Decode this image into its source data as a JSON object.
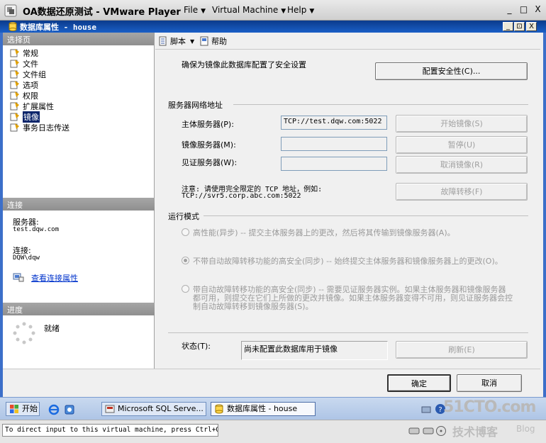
{
  "vmware": {
    "title": "OA数据还原测试 - VMware Player",
    "menus": [
      "File",
      "Virtual Machine",
      "Help"
    ],
    "window_controls": [
      "_",
      "□",
      "X"
    ]
  },
  "dialog": {
    "title": "数据库属性 - house",
    "controls": [
      "_",
      "⊡",
      "X"
    ]
  },
  "left_panel": {
    "select_page_header": "选择页",
    "pages": [
      "常规",
      "文件",
      "文件组",
      "选项",
      "权限",
      "扩展属性",
      "镜像",
      "事务日志传送"
    ],
    "selected_index": 6,
    "connection_header": "连接",
    "server_label": "服务器:",
    "server_value": "test.dqw.com",
    "connection_label": "连接:",
    "connection_value": "DQW\\dqw",
    "view_connection_link": "查看连接属性",
    "progress_header": "进度",
    "progress_status": "就绪"
  },
  "toolbar": {
    "script_label": "脚本",
    "help_label": "帮助"
  },
  "mirroring": {
    "security_note": "确保为镜像此数据库配置了安全设置",
    "configure_security_button": "配置安全性(C)...",
    "network_group": "服务器网络地址",
    "principal_label": "主体服务器(P):",
    "principal_value": "TCP://test.dqw.com:5022",
    "mirror_label": "镜像服务器(M):",
    "mirror_value": "",
    "witness_label": "见证服务器(W):",
    "witness_value": "",
    "start_button": "开始镜像(S)",
    "pause_button": "暂停(U)",
    "remove_button": "取消镜像(R)",
    "failover_button": "故障转移(F)",
    "note_line1": "注意: 请使用完全限定的 TCP 地址，例如:",
    "note_line2": "TCP://svr5.corp.abc.com:5022",
    "mode_group": "运行模式",
    "mode_high_perf": "高性能(异步) -- 提交主体服务器上的更改，然后将其传输到镜像服务器(A)。",
    "mode_high_safety": "不带自动故障转移功能的高安全(同步) -- 始终提交主体服务器和镜像服务器上的更改(O)。",
    "mode_auto_line1": "带自动故障转移功能的高安全(同步) -- 需要见证服务器实例。如果主体服务器和镜像服务器",
    "mode_auto_line2": "都可用，则提交在它们上所做的更改并镜像。如果主体服务器变得不可用，则见证服务器会控",
    "mode_auto_line3": "制自动故障转移到镜像服务器(S)。",
    "selected_mode": "high_safety",
    "status_label": "状态(T):",
    "status_value": "尚未配置此数据库用于镜像",
    "refresh_button": "刷新(E)"
  },
  "footer": {
    "ok_button": "确定",
    "cancel_button": "取消"
  },
  "taskbar": {
    "start_label": "开始",
    "items": [
      "Microsoft SQL Serve...",
      "数据库属性 - house"
    ]
  },
  "statusbar": {
    "text": "To direct input to this virtual machine, press Ctrl+G."
  },
  "watermark": {
    "site": "51CTO.com",
    "tagline": "技术博客",
    "blog": "Blog"
  }
}
